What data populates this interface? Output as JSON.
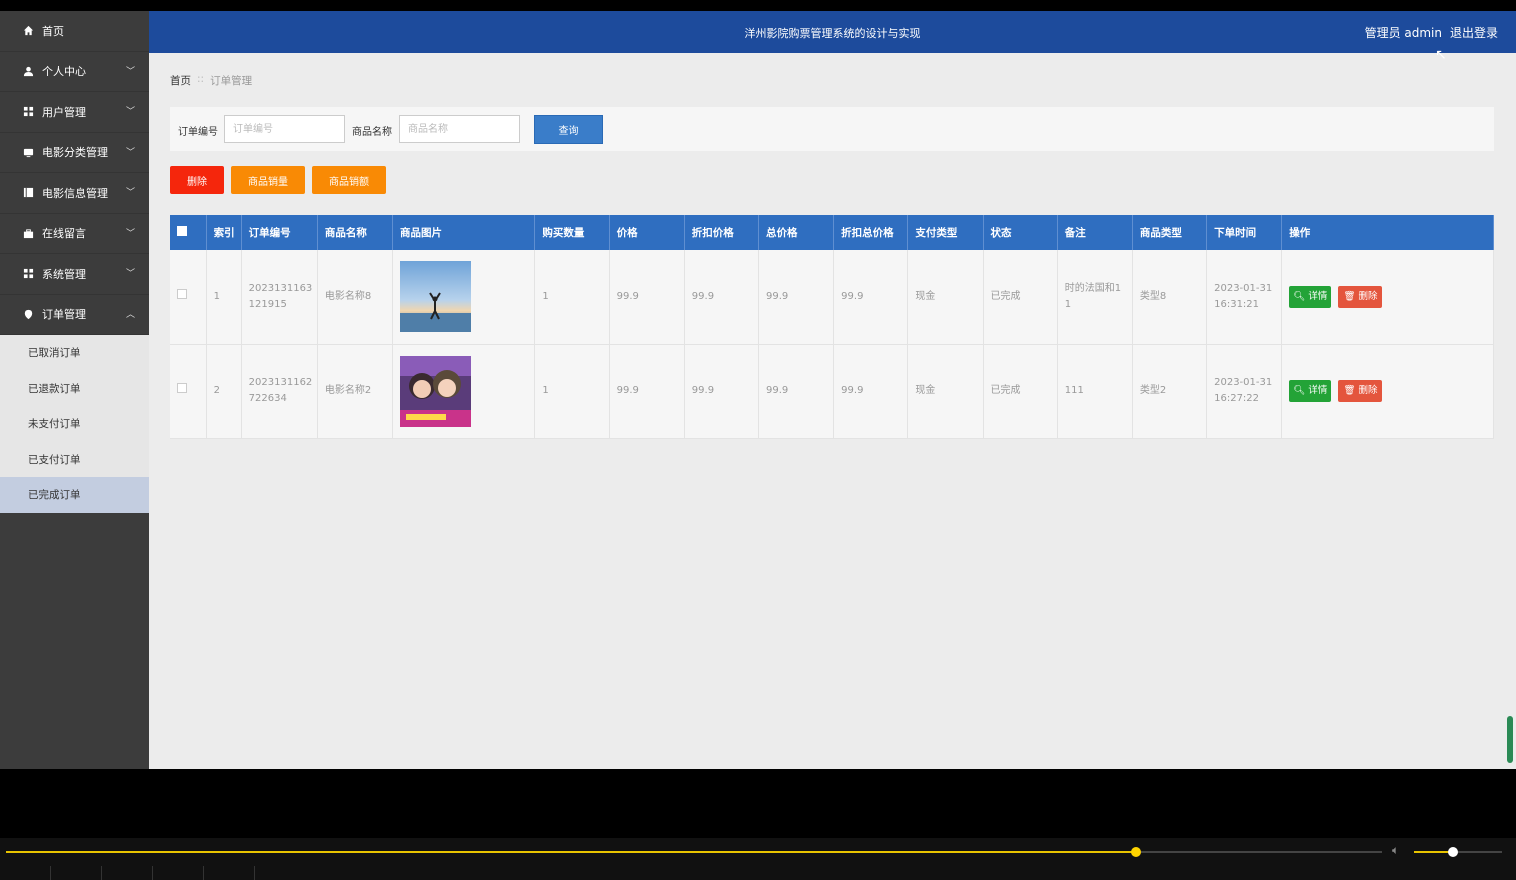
{
  "sidebar": {
    "items": [
      {
        "label": "首页",
        "icon": "home-icon",
        "chevron": ""
      },
      {
        "label": "个人中心",
        "icon": "user-icon",
        "chevron": "﹀"
      },
      {
        "label": "用户管理",
        "icon": "grid-icon",
        "chevron": "﹀"
      },
      {
        "label": "电影分类管理",
        "icon": "monitor-icon",
        "chevron": "﹀"
      },
      {
        "label": "电影信息管理",
        "icon": "book-icon",
        "chevron": "﹀"
      },
      {
        "label": "在线留言",
        "icon": "briefcase-icon",
        "chevron": "﹀"
      },
      {
        "label": "系统管理",
        "icon": "grid-icon",
        "chevron": "﹀"
      },
      {
        "label": "订单管理",
        "icon": "location-icon",
        "chevron": "︿"
      }
    ],
    "subitems": [
      "已取消订单",
      "已退款订单",
      "未支付订单",
      "已支付订单",
      "已完成订单"
    ],
    "active_subitem": "已完成订单"
  },
  "header": {
    "title": "洋州影院购票管理系统的设计与实现",
    "user": "管理员 admin",
    "logout": "退出登录"
  },
  "breadcrumb": {
    "home": "首页",
    "sep": "::",
    "current": "订单管理"
  },
  "search": {
    "order_label": "订单编号",
    "order_placeholder": "订单编号",
    "name_label": "商品名称",
    "name_placeholder": "商品名称",
    "query_label": "查询"
  },
  "actions": {
    "delete": "删除",
    "sales_qty": "商品销量",
    "sales_amount": "商品销额"
  },
  "table": {
    "headers": [
      "索引",
      "订单编号",
      "商品名称",
      "商品图片",
      "购买数量",
      "价格",
      "折扣价格",
      "总价格",
      "折扣总价格",
      "支付类型",
      "状态",
      "备注",
      "商品类型",
      "下单时间",
      "操作"
    ],
    "rows": [
      {
        "index": "1",
        "order_no_1": "2023131163",
        "order_no_2": "121915",
        "name": "电影名称8",
        "qty": "1",
        "price": "99.9",
        "discount_price": "99.9",
        "total": "99.9",
        "discount_total": "99.9",
        "pay_type": "现金",
        "status": "已完成",
        "note_1": "时的法国和1",
        "note_2": "1",
        "type": "类型8",
        "time_1": "2023-01-31",
        "time_2": "16:31:21",
        "image": "sky-jump-image"
      },
      {
        "index": "2",
        "order_no_1": "2023131162",
        "order_no_2": "722634",
        "name": "电影名称2",
        "qty": "1",
        "price": "99.9",
        "discount_price": "99.9",
        "total": "99.9",
        "discount_total": "99.9",
        "pay_type": "现金",
        "status": "已完成",
        "note_1": "111",
        "note_2": "",
        "type": "类型2",
        "time_1": "2023-01-31",
        "time_2": "16:27:22",
        "image": "selfie-image"
      }
    ],
    "detail_label": "详情",
    "delete_label": "删除"
  },
  "player": {
    "progress": 0.821,
    "volume": 0.44
  },
  "colors": {
    "header": "#1d4b9c",
    "table_head": "#2f6ec0",
    "delete": "#f5260c",
    "orange": "#f98a05",
    "detail": "#23a337",
    "row_delete": "#e4553d"
  }
}
